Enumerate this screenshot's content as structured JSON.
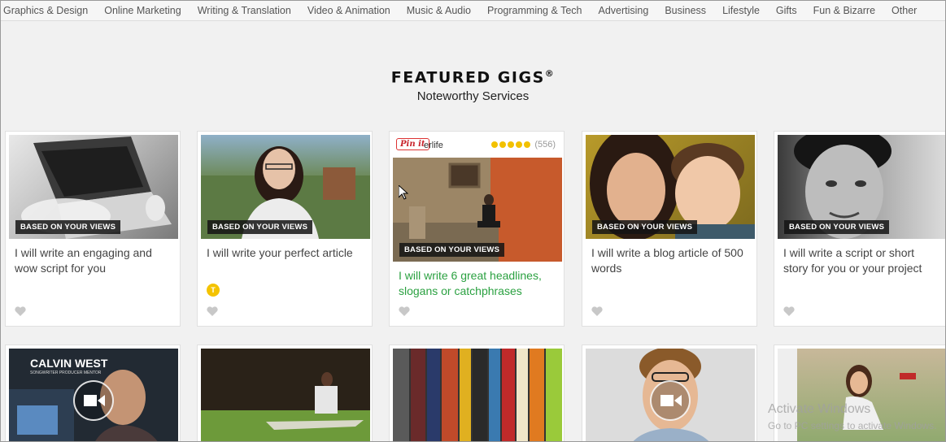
{
  "nav": {
    "items": [
      "Graphics & Design",
      "Online Marketing",
      "Writing & Translation",
      "Video & Animation",
      "Music & Audio",
      "Programming & Tech",
      "Advertising",
      "Business",
      "Lifestyle",
      "Gifts",
      "Fun & Bizarre",
      "Other"
    ]
  },
  "section": {
    "title": "FEATURED GIGS",
    "reg_mark": "®",
    "subtitle": "Noteworthy Services"
  },
  "gigs": [
    {
      "badge": "BASED ON YOUR VIEWS",
      "title": "I will write an engaging and wow script for you"
    },
    {
      "badge": "BASED ON YOUR VIEWS",
      "title": "I will write your perfect article",
      "seller_initial": "T"
    },
    {
      "badge": "BASED ON YOUR VIEWS",
      "title": "I will write 6 great headlines, slogans or catchphrases",
      "pin_label": "Pin it",
      "seller": "erlife",
      "rating_count": "(556)"
    },
    {
      "badge": "BASED ON YOUR VIEWS",
      "title": "I will write a blog article of 500 words"
    },
    {
      "badge": "BASED ON YOUR VIEWS",
      "title": "I will write a script or short story for you or your project"
    }
  ],
  "row2": {
    "thumb1_caption_name": "CALVIN WEST",
    "thumb1_caption_role": "SONGWRITER PRODUCER MENTOR"
  },
  "watermark": {
    "line1": "Activate Windows",
    "line2": "Go to PC settings to activate Windows."
  },
  "colors": {
    "link_hover": "#2ba141",
    "star": "#f2c100",
    "pin": "#c8232c"
  }
}
